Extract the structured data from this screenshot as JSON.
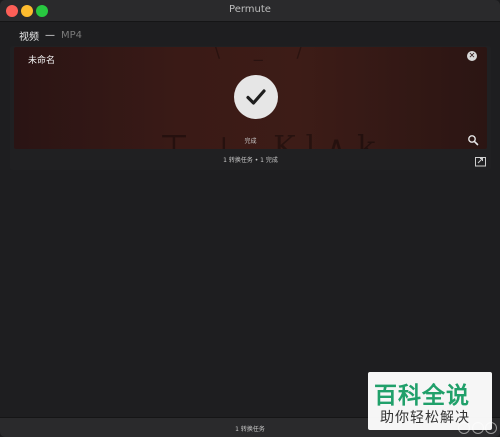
{
  "window": {
    "title": "Permute"
  },
  "preset": {
    "category": "视频",
    "separator": "—",
    "format": "MP4"
  },
  "job": {
    "file_name": "未命名",
    "status_text": "完成",
    "summary": "1 转换任务 • 1 完成"
  },
  "statusbar": {
    "text": "1 转换任务"
  },
  "colors": {
    "accent_done": "#e6e6e6",
    "thumbnail": "#3a1a16"
  },
  "icons": [
    "close-icon",
    "checkmark-icon",
    "search-icon",
    "open-folder-icon"
  ],
  "watermark": {
    "line1": "百科全说",
    "line2": "助你轻松解决"
  }
}
